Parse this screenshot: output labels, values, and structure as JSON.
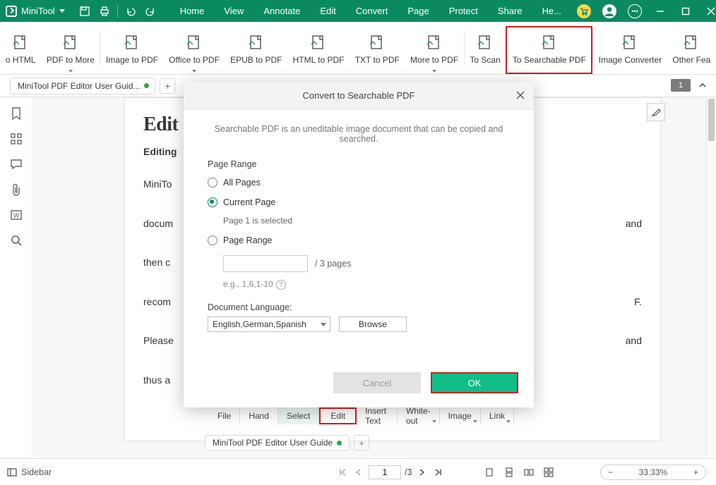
{
  "app": {
    "name": "MiniTool"
  },
  "menu": [
    "Home",
    "View",
    "Annotate",
    "Edit",
    "Convert",
    "Page",
    "Protect",
    "Share",
    "He..."
  ],
  "ribbon": {
    "items": [
      {
        "label": "o HTML",
        "drop": false
      },
      {
        "label": "PDF to More",
        "drop": true
      },
      {
        "sep": true
      },
      {
        "label": "Image to PDF",
        "drop": false
      },
      {
        "label": "Office to PDF",
        "drop": true
      },
      {
        "label": "EPUB to PDF",
        "drop": false
      },
      {
        "label": "HTML to PDF",
        "drop": false
      },
      {
        "label": "TXT to PDF",
        "drop": false
      },
      {
        "label": "More to PDF",
        "drop": true
      },
      {
        "sep": true
      },
      {
        "label": "To Scan",
        "drop": false
      },
      {
        "label": "To Searchable PDF",
        "drop": false,
        "highlight": true
      },
      {
        "sep": true
      },
      {
        "label": "Image Converter",
        "drop": false
      },
      {
        "label": "Other Fea",
        "drop": false
      }
    ]
  },
  "doctab": {
    "title": "MiniTool PDF Editor User Guid...",
    "count_badge": "1",
    "plus": "+"
  },
  "page": {
    "h1": "Edit",
    "h3": "Editing",
    "p1": "MiniTo                                                                                                           ",
    "p1_tail": "",
    "p2a": "docum",
    "p2b": "and",
    "p3": "then c",
    "p4a": "recom",
    "p4b": "F.",
    "p5a": "Please",
    "p5b": "and",
    "p6": "thus a"
  },
  "modal": {
    "title": "Convert to Searchable PDF",
    "desc": "Searchable PDF is an uneditable image document that can be copied and searched.",
    "page_range_label": "Page Range",
    "opt_all": "All Pages",
    "opt_current": "Current Page",
    "current_info": "Page 1 is selected",
    "opt_range": "Page Range",
    "range_suffix": "/ 3 pages",
    "range_eg": "e.g., 1,6,1-10",
    "lang_label": "Document Language:",
    "lang_value": "English,German,Spanish",
    "browse": "Browse",
    "cancel": "Cancel",
    "ok": "OK"
  },
  "toolrow": {
    "items": [
      "File",
      "Hand",
      "Select",
      "Edit",
      "Insert Text",
      "White-out",
      "Image",
      "Link"
    ]
  },
  "lowertab": {
    "title": "MiniTool PDF Editor User Guide",
    "plus": "+"
  },
  "status": {
    "sidebar": "Sidebar",
    "page_current": "1",
    "page_total": "/3",
    "zoom": "33.33%"
  }
}
